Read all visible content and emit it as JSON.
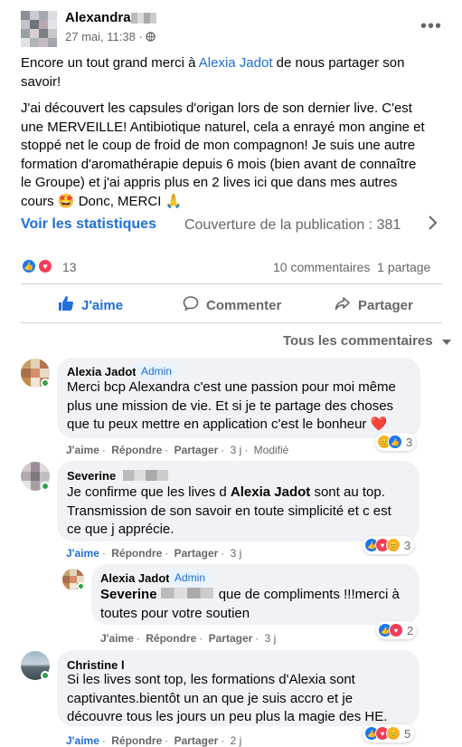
{
  "post": {
    "author": "Alexandra",
    "date": "27 mai, 11:38",
    "privacy_icon": "globe-icon",
    "menu_icon": "more-dots-icon",
    "text_p1_before": "Encore un tout grand merci à ",
    "text_p1_link": "Alexia Jadot",
    "text_p1_after": " de nous partager son",
    "text_p1_line2": "savoir!",
    "body_lines": [
      "J'ai découvert les capsules d'origan lors de son dernier live. C'est",
      "une MERVEILLE! Antibiotique naturel, cela a enrayé mon angine et",
      "stoppé net le coup de froid de mon compagnon! Je suis une autre",
      "formation d'aromathérapie depuis 6 mois (bien avant de connaître",
      "le Groupe) et j'ai appris plus en 2 lives ici que dans mes autres",
      "cours 🤩 Donc, MERCI 🙏"
    ],
    "stats_link": "Voir les statistiques",
    "reach": "Couverture de la publication : 381",
    "reactions_count": "13",
    "comments_count": "10 commentaires",
    "shares_count": "1 partage"
  },
  "actions": {
    "like": "J'aime",
    "comment": "Commenter",
    "share": "Partager"
  },
  "sort": {
    "label": "Tous les commentaires"
  },
  "comments": [
    {
      "name": "Alexia Jadot",
      "badge": "Admin",
      "lines": [
        "Merci bcp Alexandra c'est une passion pour moi même",
        "plus une mission de vie. Et si je te partage des choses",
        "que tu peux mettre en application c'est le bonheur ❤️"
      ],
      "like": "J'aime",
      "reply": "Répondre",
      "share": "Partager",
      "time": "3 j",
      "edited": "Modifié",
      "reactions": "3"
    },
    {
      "name": "Severine",
      "line1_before": "Je confirme que les lives d ",
      "line1_bold": "Alexia Jadot",
      "line1_after": " sont au top.",
      "lines": [
        "Transmission de son savoir en toute simplicité et c est",
        "ce que j apprécie."
      ],
      "like": "J'aime",
      "reply": "Répondre",
      "share": "Partager",
      "time": "3 j",
      "reactions": "3"
    },
    {
      "name": "Alexia Jadot",
      "badge": "Admin",
      "mention": "Severine",
      "line1_after": " que de compliments !!!merci à",
      "lines": [
        "toutes pour votre soutien"
      ],
      "like": "J'aime",
      "reply": "Répondre",
      "share": "Partager",
      "time": "3 j",
      "reactions": "2"
    },
    {
      "name": "Christine l",
      "lines": [
        "Si les lives sont top, les formations d'Alexia sont",
        "captivantes.bientôt un an que je suis accro et je",
        "découvre tous les jours un peu plus la magie des HE."
      ],
      "like": "J'aime",
      "reply": "Répondre",
      "share": "Partager",
      "time": "2 j",
      "reactions": "5"
    }
  ],
  "colors": {
    "accent": "#216fdb",
    "like": "#1877f2",
    "love": "#f33e58",
    "online": "#31a24c"
  }
}
